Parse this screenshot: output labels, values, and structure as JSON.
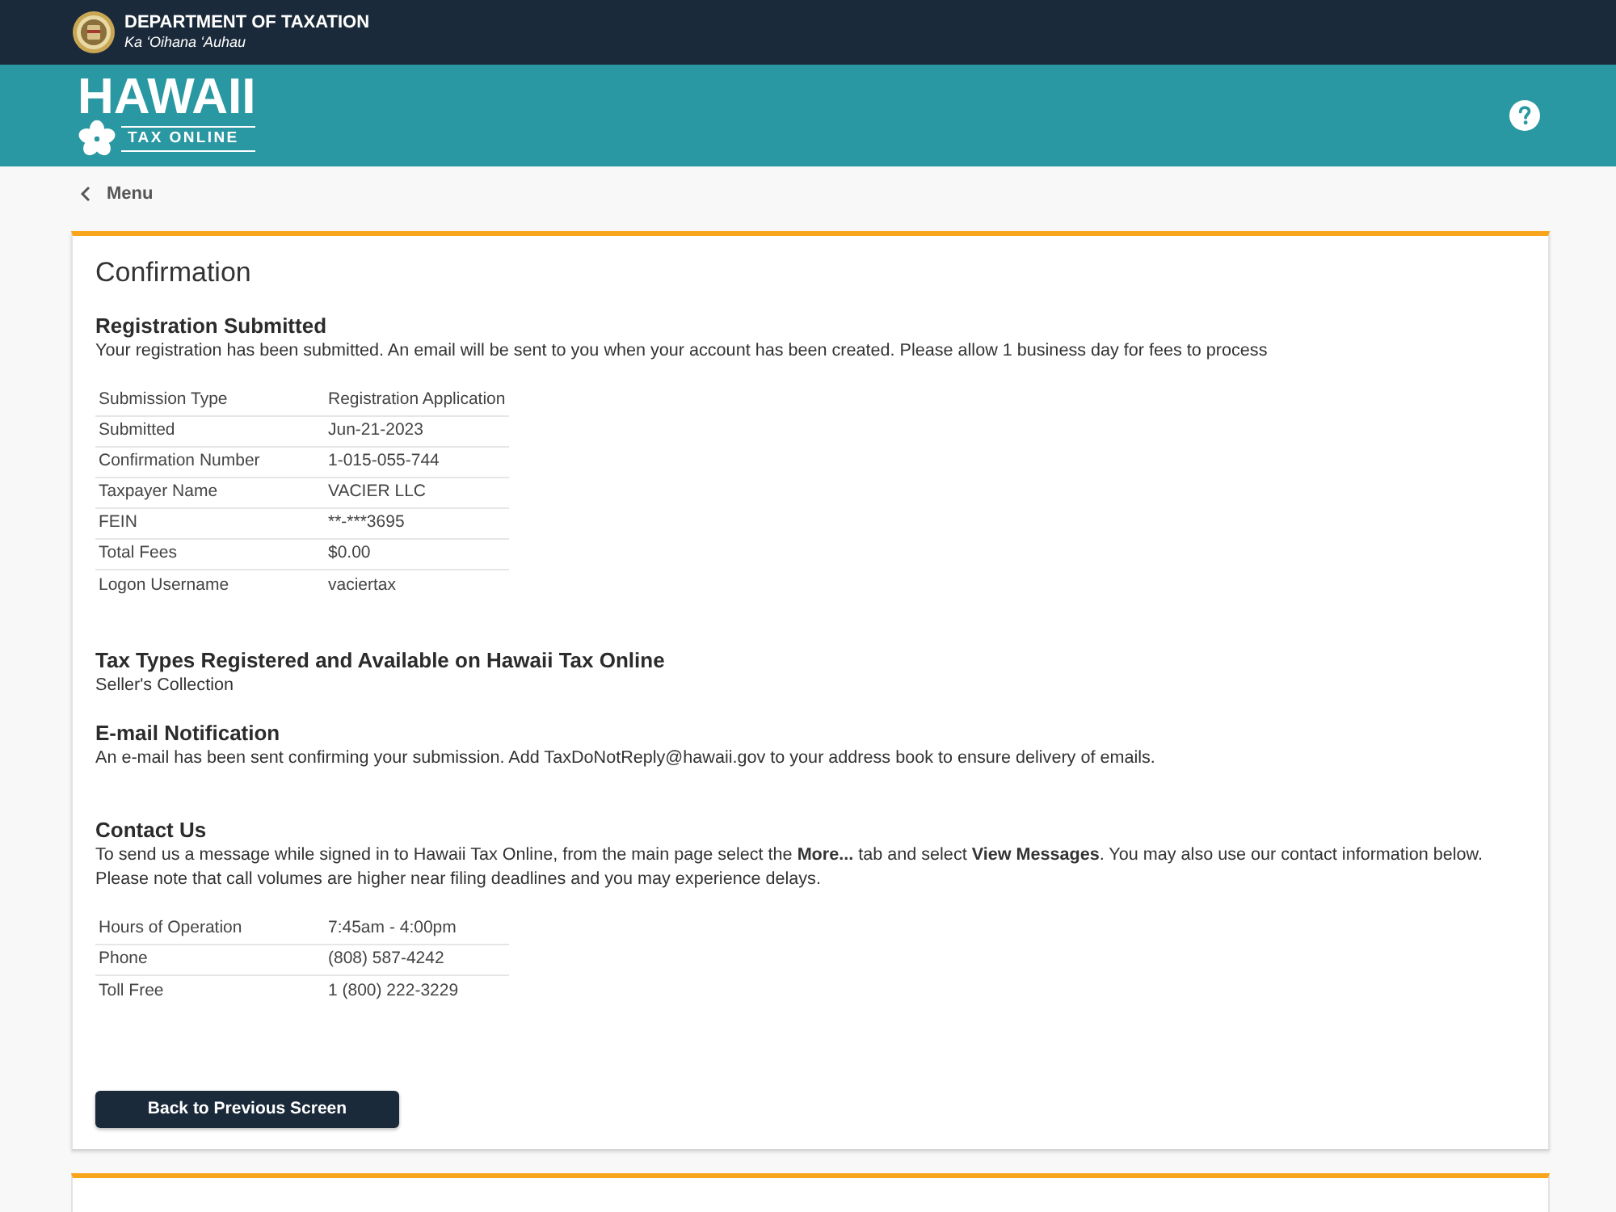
{
  "header": {
    "department": "DEPARTMENT OF TAXATION",
    "subtitle": "Ka ʻOihana ʻAuhau"
  },
  "banner": {
    "logo_title": "HAWAII",
    "logo_subtitle": "TAX ONLINE"
  },
  "nav": {
    "back_label": "Menu"
  },
  "confirmation": {
    "title": "Confirmation",
    "sections": [
      {
        "kind": "summary",
        "heading": "Registration Submitted",
        "text": "Your registration has been submitted. An email will be sent to you when your account has been created. Please allow 1 business day for fees to process",
        "rows": [
          {
            "label": "Submission Type",
            "value": "Registration Application"
          },
          {
            "label": "Submitted",
            "value": "Jun-21-2023"
          },
          {
            "label": "Confirmation Number",
            "value": "1-015-055-744"
          },
          {
            "label": "Taxpayer Name",
            "value": "VACIER LLC"
          },
          {
            "label": "FEIN",
            "value": "**-***3695"
          },
          {
            "label": "Total Fees",
            "value": "$0.00"
          },
          {
            "label": "Logon Username",
            "value": "vaciertax"
          }
        ]
      },
      {
        "kind": "text",
        "heading": "Tax Types Registered and Available on Hawaii Tax Online",
        "text": "Seller's Collection"
      },
      {
        "kind": "text",
        "heading": "E-mail Notification",
        "text": "An e-mail has been sent confirming your submission. Add TaxDoNotReply@hawaii.gov to your address book to ensure delivery of emails."
      },
      {
        "kind": "summary",
        "heading": "Contact Us",
        "text": "To send us a message while signed in to Hawaii Tax Online, from the main page select the **More...** tab and select **View Messages**. You may also use our contact information below. Please note that call volumes are higher near filing deadlines and you may experience delays.",
        "rows": [
          {
            "label": "Hours of Operation",
            "value": "7:45am - 4:00pm"
          },
          {
            "label": "Phone",
            "value": "(808) 587-4242"
          },
          {
            "label": "Toll Free",
            "value": "1 (800) 222-3229"
          }
        ]
      }
    ],
    "button": "Back to Previous Screen"
  }
}
